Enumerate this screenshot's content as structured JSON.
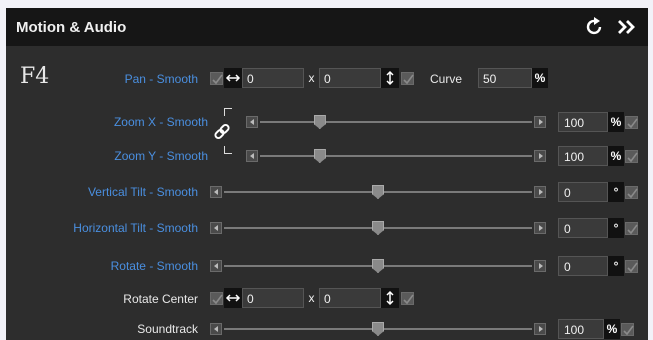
{
  "panel": {
    "title": "Motion & Audio",
    "badge": "F4"
  },
  "pan": {
    "label": "Pan - Smooth",
    "x_value": "0",
    "x_sep": "x",
    "y_value": "0",
    "curve_label": "Curve",
    "curve_value": "50",
    "curve_unit": "%"
  },
  "sliders": [
    {
      "label": "Zoom X - Smooth",
      "value": "100",
      "unit": "%",
      "level": 0.22,
      "color": "blue"
    },
    {
      "label": "Zoom Y - Smooth",
      "value": "100",
      "unit": "%",
      "level": 0.22,
      "color": "blue"
    },
    {
      "label": "Vertical Tilt - Smooth",
      "value": "0",
      "unit": "°",
      "level": 0.5,
      "color": "blue"
    },
    {
      "label": "Horizontal Tilt - Smooth",
      "value": "0",
      "unit": "°",
      "level": 0.5,
      "color": "blue"
    },
    {
      "label": "Rotate - Smooth",
      "value": "0",
      "unit": "°",
      "level": 0.5,
      "color": "blue"
    }
  ],
  "rotate_center": {
    "label": "Rotate Center",
    "x_value": "0",
    "x_sep": "x",
    "y_value": "0"
  },
  "soundtrack": {
    "label": "Soundtrack",
    "value": "100",
    "unit": "%",
    "level": 0.5
  },
  "icons": {
    "reset": "reset-icon",
    "expand": "double-chevron-right-icon",
    "link": "chain-link-icon"
  },
  "colors": {
    "label_blue": "#4a8fe0",
    "panel_bg": "#2d2d2d",
    "header_bg": "#161616"
  }
}
